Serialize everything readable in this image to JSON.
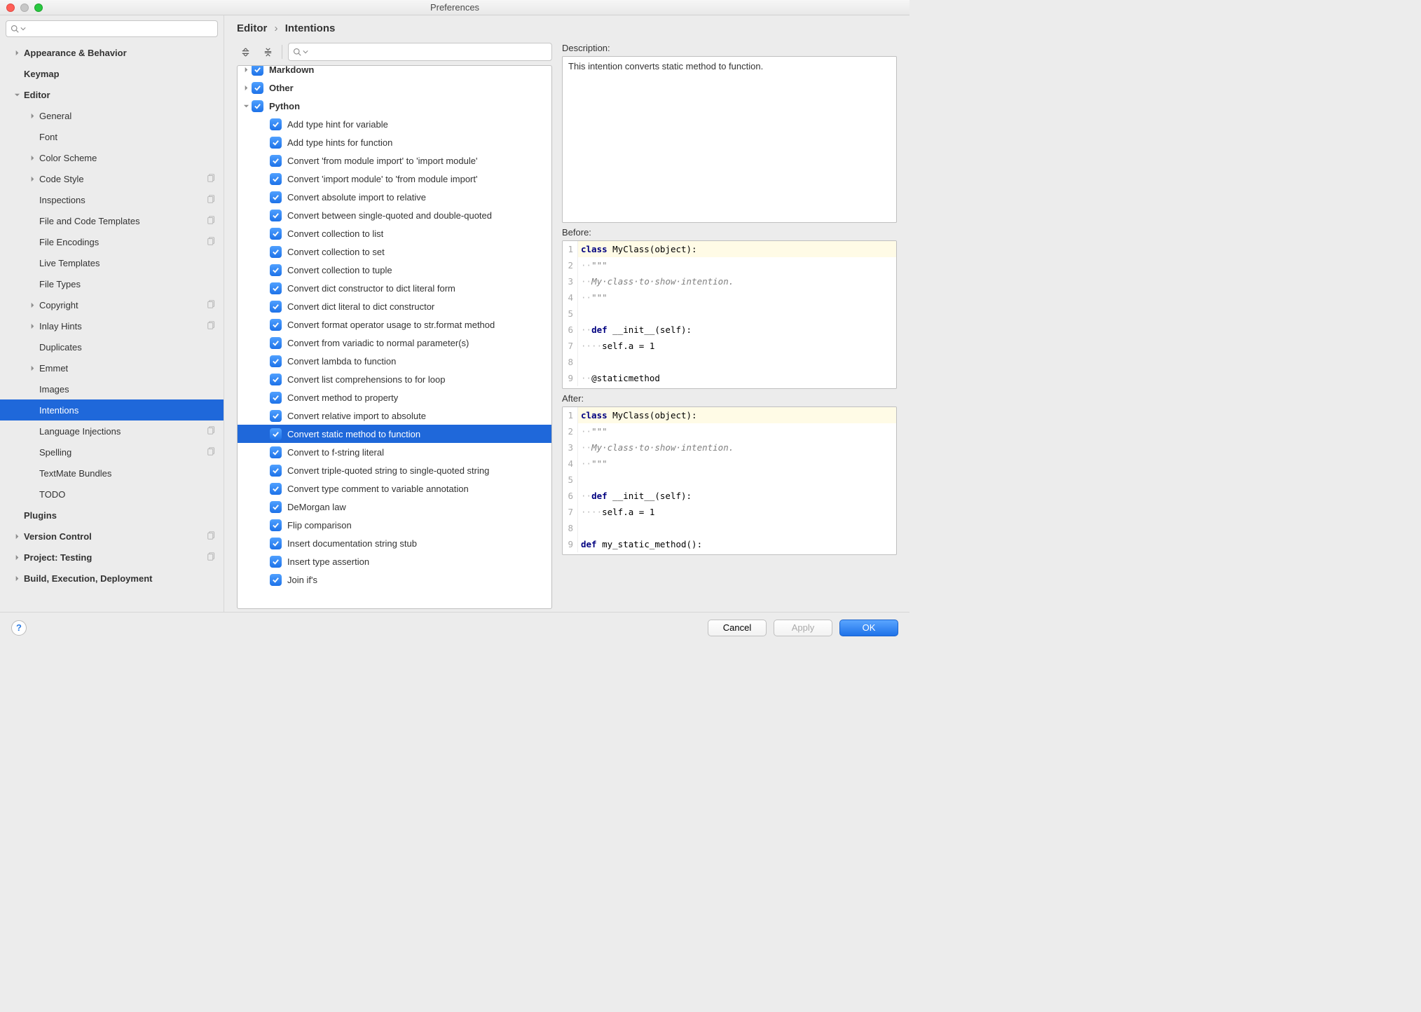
{
  "window": {
    "title": "Preferences"
  },
  "sidebar": {
    "search_placeholder": "",
    "items": [
      {
        "label": "Appearance & Behavior",
        "level": 0,
        "bold": true,
        "disclosure": "right",
        "badge": false
      },
      {
        "label": "Keymap",
        "level": 0,
        "bold": true,
        "disclosure": "none",
        "badge": false
      },
      {
        "label": "Editor",
        "level": 0,
        "bold": true,
        "disclosure": "down",
        "badge": false
      },
      {
        "label": "General",
        "level": 1,
        "bold": false,
        "disclosure": "right",
        "badge": false
      },
      {
        "label": "Font",
        "level": 1,
        "bold": false,
        "disclosure": "none",
        "badge": false
      },
      {
        "label": "Color Scheme",
        "level": 1,
        "bold": false,
        "disclosure": "right",
        "badge": false
      },
      {
        "label": "Code Style",
        "level": 1,
        "bold": false,
        "disclosure": "right",
        "badge": true
      },
      {
        "label": "Inspections",
        "level": 1,
        "bold": false,
        "disclosure": "none",
        "badge": true
      },
      {
        "label": "File and Code Templates",
        "level": 1,
        "bold": false,
        "disclosure": "none",
        "badge": true
      },
      {
        "label": "File Encodings",
        "level": 1,
        "bold": false,
        "disclosure": "none",
        "badge": true
      },
      {
        "label": "Live Templates",
        "level": 1,
        "bold": false,
        "disclosure": "none",
        "badge": false
      },
      {
        "label": "File Types",
        "level": 1,
        "bold": false,
        "disclosure": "none",
        "badge": false
      },
      {
        "label": "Copyright",
        "level": 1,
        "bold": false,
        "disclosure": "right",
        "badge": true
      },
      {
        "label": "Inlay Hints",
        "level": 1,
        "bold": false,
        "disclosure": "right",
        "badge": true
      },
      {
        "label": "Duplicates",
        "level": 1,
        "bold": false,
        "disclosure": "none",
        "badge": false
      },
      {
        "label": "Emmet",
        "level": 1,
        "bold": false,
        "disclosure": "right",
        "badge": false
      },
      {
        "label": "Images",
        "level": 1,
        "bold": false,
        "disclosure": "none",
        "badge": false
      },
      {
        "label": "Intentions",
        "level": 1,
        "bold": false,
        "disclosure": "none",
        "badge": false,
        "selected": true
      },
      {
        "label": "Language Injections",
        "level": 1,
        "bold": false,
        "disclosure": "none",
        "badge": true
      },
      {
        "label": "Spelling",
        "level": 1,
        "bold": false,
        "disclosure": "none",
        "badge": true
      },
      {
        "label": "TextMate Bundles",
        "level": 1,
        "bold": false,
        "disclosure": "none",
        "badge": false
      },
      {
        "label": "TODO",
        "level": 1,
        "bold": false,
        "disclosure": "none",
        "badge": false
      },
      {
        "label": "Plugins",
        "level": 0,
        "bold": true,
        "disclosure": "none",
        "badge": false
      },
      {
        "label": "Version Control",
        "level": 0,
        "bold": true,
        "disclosure": "right",
        "badge": true
      },
      {
        "label": "Project: Testing",
        "level": 0,
        "bold": true,
        "disclosure": "right",
        "badge": true
      },
      {
        "label": "Build, Execution, Deployment",
        "level": 0,
        "bold": true,
        "disclosure": "right",
        "badge": false
      }
    ]
  },
  "breadcrumb": {
    "root": "Editor",
    "leaf": "Intentions"
  },
  "intentions": {
    "search_placeholder": "",
    "items": [
      {
        "label": "Markdown",
        "level": 0,
        "disclosure": "right",
        "checked": true,
        "bold": true,
        "cut": true
      },
      {
        "label": "Other",
        "level": 0,
        "disclosure": "right",
        "checked": true,
        "bold": true
      },
      {
        "label": "Python",
        "level": 0,
        "disclosure": "down",
        "checked": true,
        "bold": true
      },
      {
        "label": "Add type hint for variable",
        "level": 1,
        "disclosure": "none",
        "checked": true
      },
      {
        "label": "Add type hints for function",
        "level": 1,
        "disclosure": "none",
        "checked": true
      },
      {
        "label": "Convert 'from module import' to 'import module'",
        "level": 1,
        "disclosure": "none",
        "checked": true
      },
      {
        "label": "Convert 'import module' to 'from module import'",
        "level": 1,
        "disclosure": "none",
        "checked": true
      },
      {
        "label": "Convert absolute import to relative",
        "level": 1,
        "disclosure": "none",
        "checked": true
      },
      {
        "label": "Convert between single-quoted and double-quoted",
        "level": 1,
        "disclosure": "none",
        "checked": true
      },
      {
        "label": "Convert collection to list",
        "level": 1,
        "disclosure": "none",
        "checked": true
      },
      {
        "label": "Convert collection to set",
        "level": 1,
        "disclosure": "none",
        "checked": true
      },
      {
        "label": "Convert collection to tuple",
        "level": 1,
        "disclosure": "none",
        "checked": true
      },
      {
        "label": "Convert dict constructor to dict literal form",
        "level": 1,
        "disclosure": "none",
        "checked": true
      },
      {
        "label": "Convert dict literal to dict constructor",
        "level": 1,
        "disclosure": "none",
        "checked": true
      },
      {
        "label": "Convert format operator usage to str.format method",
        "level": 1,
        "disclosure": "none",
        "checked": true
      },
      {
        "label": "Convert from variadic to normal parameter(s)",
        "level": 1,
        "disclosure": "none",
        "checked": true
      },
      {
        "label": "Convert lambda to function",
        "level": 1,
        "disclosure": "none",
        "checked": true
      },
      {
        "label": "Convert list comprehensions to for loop",
        "level": 1,
        "disclosure": "none",
        "checked": true
      },
      {
        "label": "Convert method to property",
        "level": 1,
        "disclosure": "none",
        "checked": true
      },
      {
        "label": "Convert relative import to absolute",
        "level": 1,
        "disclosure": "none",
        "checked": true
      },
      {
        "label": "Convert static method to function",
        "level": 1,
        "disclosure": "none",
        "checked": true,
        "selected": true
      },
      {
        "label": "Convert to f-string literal",
        "level": 1,
        "disclosure": "none",
        "checked": true
      },
      {
        "label": "Convert triple-quoted string to single-quoted string",
        "level": 1,
        "disclosure": "none",
        "checked": true
      },
      {
        "label": "Convert type comment to variable annotation",
        "level": 1,
        "disclosure": "none",
        "checked": true
      },
      {
        "label": "DeMorgan law",
        "level": 1,
        "disclosure": "none",
        "checked": true
      },
      {
        "label": "Flip comparison",
        "level": 1,
        "disclosure": "none",
        "checked": true
      },
      {
        "label": "Insert documentation string stub",
        "level": 1,
        "disclosure": "none",
        "checked": true
      },
      {
        "label": "Insert type assertion",
        "level": 1,
        "disclosure": "none",
        "checked": true
      },
      {
        "label": "Join if's",
        "level": 1,
        "disclosure": "none",
        "checked": true
      }
    ]
  },
  "details": {
    "description_label": "Description:",
    "description_text": "This intention converts static method to function.",
    "before_label": "Before:",
    "after_label": "After:",
    "before_code": [
      {
        "n": 1,
        "hl": true,
        "tokens": [
          {
            "t": "kw",
            "v": "class "
          },
          {
            "t": "fn",
            "v": "MyClass(object):"
          }
        ]
      },
      {
        "n": 2,
        "tokens": [
          {
            "t": "dot",
            "v": "··"
          },
          {
            "t": "str",
            "v": "\"\"\""
          }
        ]
      },
      {
        "n": 3,
        "tokens": [
          {
            "t": "dot",
            "v": "··"
          },
          {
            "t": "comment",
            "v": "My·class·to·show·intention."
          }
        ]
      },
      {
        "n": 4,
        "tokens": [
          {
            "t": "dot",
            "v": "··"
          },
          {
            "t": "str",
            "v": "\"\"\""
          }
        ]
      },
      {
        "n": 5,
        "tokens": []
      },
      {
        "n": 6,
        "tokens": [
          {
            "t": "dot",
            "v": "··"
          },
          {
            "t": "kw",
            "v": "def "
          },
          {
            "t": "fn",
            "v": "__init__(self):"
          }
        ]
      },
      {
        "n": 7,
        "tokens": [
          {
            "t": "dot",
            "v": "····"
          },
          {
            "t": "fn",
            "v": "self.a = 1"
          }
        ]
      },
      {
        "n": 8,
        "tokens": []
      },
      {
        "n": 9,
        "tokens": [
          {
            "t": "dot",
            "v": "··"
          },
          {
            "t": "fn",
            "v": "@staticmethod"
          }
        ]
      }
    ],
    "after_code": [
      {
        "n": 1,
        "hl": true,
        "tokens": [
          {
            "t": "kw",
            "v": "class "
          },
          {
            "t": "fn",
            "v": "MyClass(object):"
          }
        ]
      },
      {
        "n": 2,
        "tokens": [
          {
            "t": "dot",
            "v": "··"
          },
          {
            "t": "str",
            "v": "\"\"\""
          }
        ]
      },
      {
        "n": 3,
        "tokens": [
          {
            "t": "dot",
            "v": "··"
          },
          {
            "t": "comment",
            "v": "My·class·to·show·intention."
          }
        ]
      },
      {
        "n": 4,
        "tokens": [
          {
            "t": "dot",
            "v": "··"
          },
          {
            "t": "str",
            "v": "\"\"\""
          }
        ]
      },
      {
        "n": 5,
        "tokens": []
      },
      {
        "n": 6,
        "tokens": [
          {
            "t": "dot",
            "v": "··"
          },
          {
            "t": "kw",
            "v": "def "
          },
          {
            "t": "fn",
            "v": "__init__(self):"
          }
        ]
      },
      {
        "n": 7,
        "tokens": [
          {
            "t": "dot",
            "v": "····"
          },
          {
            "t": "fn",
            "v": "self.a = 1"
          }
        ]
      },
      {
        "n": 8,
        "tokens": []
      },
      {
        "n": 9,
        "tokens": [
          {
            "t": "kw",
            "v": "def "
          },
          {
            "t": "fn",
            "v": "my_static_method():"
          }
        ]
      }
    ]
  },
  "footer": {
    "cancel": "Cancel",
    "apply": "Apply",
    "ok": "OK"
  }
}
